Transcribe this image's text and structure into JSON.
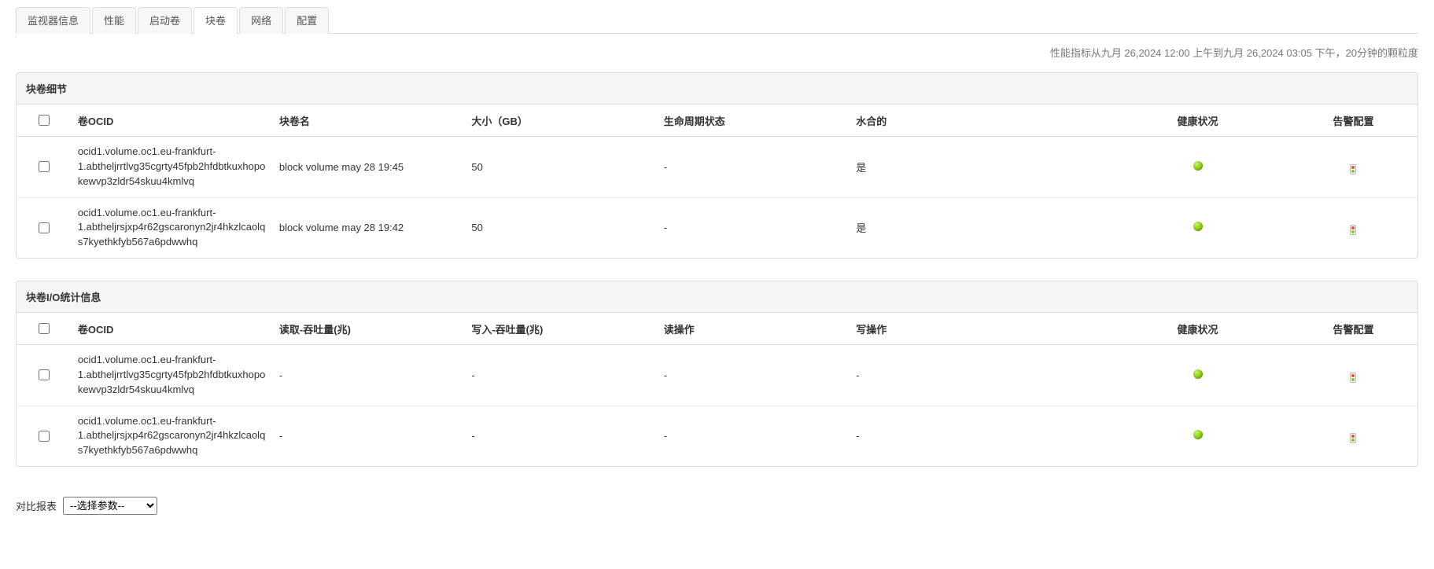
{
  "tabs": {
    "items": [
      {
        "label": "监视器信息",
        "active": false
      },
      {
        "label": "性能",
        "active": false
      },
      {
        "label": "启动卷",
        "active": false
      },
      {
        "label": "块卷",
        "active": true
      },
      {
        "label": "网络",
        "active": false
      },
      {
        "label": "配置",
        "active": false
      }
    ]
  },
  "perf_note": "性能指标从九月 26,2024 12:00 上午到九月 26,2024 03:05 下午，20分钟的颗粒度",
  "panel1": {
    "title": "块卷细节",
    "headers": {
      "ocid": "卷OCID",
      "name": "块卷名",
      "size": "大小（GB）",
      "life": "生命周期状态",
      "hyd": "水合的",
      "health": "健康状况",
      "alert": "告警配置"
    },
    "rows": [
      {
        "ocid": "ocid1.volume.oc1.eu-frankfurt-1.abtheljrrtlvg35cgrty45fpb2hfdbtkuxhopokewvp3zldr54skuu4kmlvq",
        "name": "block volume may 28 19:45",
        "size": "50",
        "life": "-",
        "hyd": "是"
      },
      {
        "ocid": "ocid1.volume.oc1.eu-frankfurt-1.abtheljrsjxp4r62gscaronyn2jr4hkzlcaolqs7kyethkfyb567a6pdwwhq",
        "name": "block volume may 28 19:42",
        "size": "50",
        "life": "-",
        "hyd": "是"
      }
    ]
  },
  "panel2": {
    "title": "块卷I/O统计信息",
    "headers": {
      "ocid": "卷OCID",
      "read": "读取-吞吐量(兆)",
      "write": "写入-吞吐量(兆)",
      "rop": "读操作",
      "wop": "写操作",
      "health": "健康状况",
      "alert": "告警配置"
    },
    "rows": [
      {
        "ocid": "ocid1.volume.oc1.eu-frankfurt-1.abtheljrrtlvg35cgrty45fpb2hfdbtkuxhopokewvp3zldr54skuu4kmlvq",
        "read": "-",
        "write": "-",
        "rop": "-",
        "wop": "-"
      },
      {
        "ocid": "ocid1.volume.oc1.eu-frankfurt-1.abtheljrsjxp4r62gscaronyn2jr4hkzlcaolqs7kyethkfyb567a6pdwwhq",
        "read": "-",
        "write": "-",
        "rop": "-",
        "wop": "-"
      }
    ]
  },
  "compare": {
    "label": "对比报表",
    "placeholder": "--选择参数--"
  }
}
